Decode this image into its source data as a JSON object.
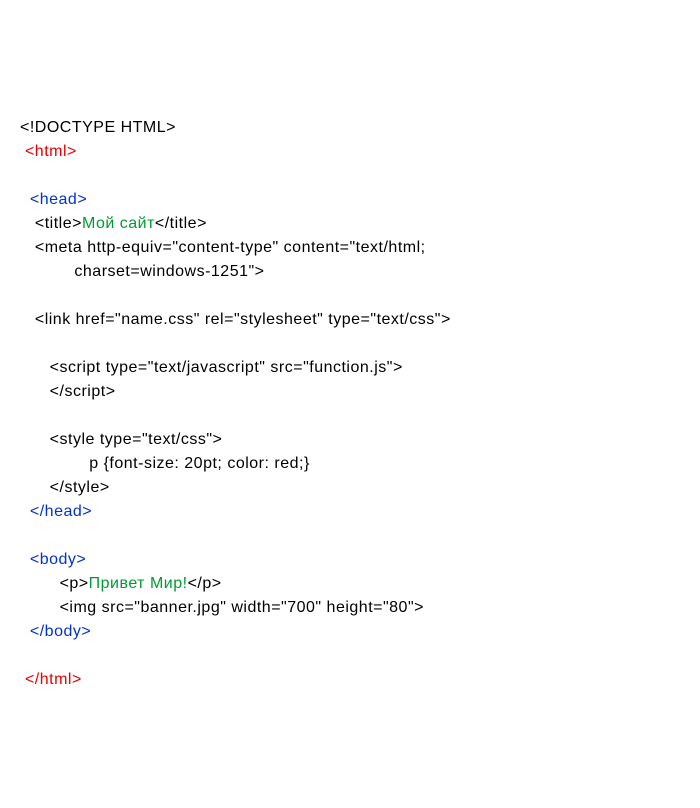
{
  "t": {
    "doctype": "<!DOCTYPE HTML>",
    "html_open": "<html>",
    "head_open": "<head>",
    "title_open": "<title>",
    "title_text": "Мой сайт",
    "title_close": "</title>",
    "meta_line1": "<meta http-equiv=\"content-type\" content=\"text/html;",
    "meta_line2": "charset=windows-1251\">",
    "link_line": "<link href=\"name.css\" rel=\"stylesheet\" type=\"text/css\">",
    "script_open": "<script type=\"text/javascript\" src=\"function.js\">",
    "script_close": "</script>",
    "style_open": "<style type=\"text/css\">",
    "style_rule": "p {font-size: 20pt; color: red;}",
    "style_close": "</style>",
    "head_close": "</head>",
    "body_open": "<body>",
    "p_open": "<p>",
    "p_text": "Привет Мир!",
    "p_close": "</p>",
    "img_line": "<img src=\"banner.jpg\" width=\"700\" height=\"80\">",
    "body_close": "</body>",
    "html_close": "</html>"
  },
  "colors": {
    "black": "#000000",
    "red": "#e60000",
    "blue": "#0033cc",
    "green": "#009933"
  }
}
